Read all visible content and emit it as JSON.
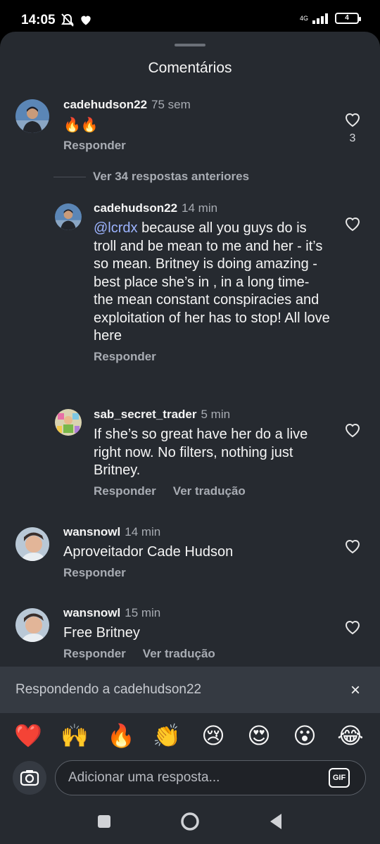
{
  "status": {
    "time": "14:05",
    "network": "4G",
    "battery": "4",
    "icons": [
      "do-not-disturb-icon",
      "heart-icon",
      "signal-icon",
      "battery-icon"
    ]
  },
  "sheet": {
    "title": "Comentários"
  },
  "comments": [
    {
      "user": "cadehudson22",
      "time": "75 sem",
      "text": "🔥🔥",
      "actions": [
        "Responder"
      ],
      "likes": "3"
    }
  ],
  "view_replies": "Ver 34 respostas anteriores",
  "replies": [
    {
      "user": "cadehudson22",
      "time": "14 min",
      "mention": "@lcrdx",
      "text": " because all you guys do is troll and be mean to me and her - it’s so mean. Britney is doing amazing - best place she’s in , in a long time- the mean constant conspiracies and exploitation of her has to stop! All love here",
      "actions": [
        "Responder"
      ]
    },
    {
      "user": "sab_secret_trader",
      "time": "5 min",
      "text": "If she’s so great have her do a live right now. No filters, nothing just Britney.",
      "actions": [
        "Responder",
        "Ver tradução"
      ]
    }
  ],
  "more_comments": [
    {
      "user": "wansnowl",
      "time": "14 min",
      "text": "Aproveitador Cade Hudson",
      "actions": [
        "Responder"
      ]
    },
    {
      "user": "wansnowl",
      "time": "15 min",
      "text": "Free Britney",
      "actions": [
        "Responder",
        "Ver tradução"
      ]
    }
  ],
  "reply_bar": {
    "label": "Respondendo a cadehudson22",
    "close": "×"
  },
  "emojis": [
    "❤️",
    "🙌",
    "🔥",
    "👏",
    "😢",
    "😍",
    "😮",
    "😂"
  ],
  "input": {
    "placeholder": "Adicionar uma resposta...",
    "gif": "GIF"
  },
  "colors": {
    "sheet_bg": "#262a30",
    "mention": "#9db4ff",
    "muted": "#a8acb3"
  }
}
